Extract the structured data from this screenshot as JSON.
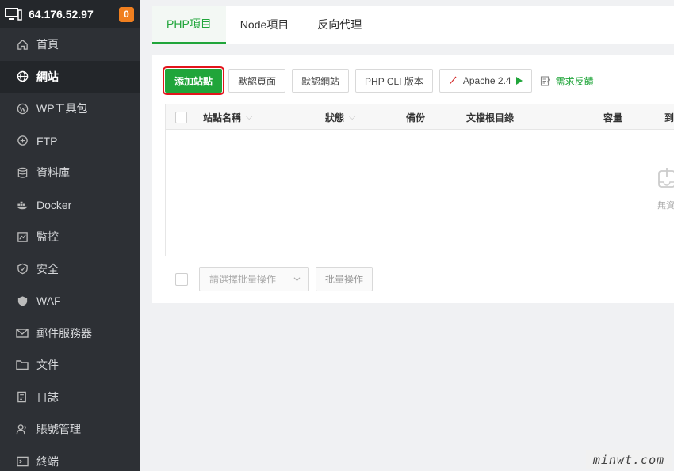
{
  "header": {
    "ip": "64.176.52.97",
    "badge": "0"
  },
  "sidebar": {
    "items": [
      {
        "label": "首頁",
        "icon": "home-icon"
      },
      {
        "label": "網站",
        "icon": "globe-icon",
        "active": true
      },
      {
        "label": "WP工具包",
        "icon": "wordpress-icon"
      },
      {
        "label": "FTP",
        "icon": "ftp-icon"
      },
      {
        "label": "資料庫",
        "icon": "database-icon"
      },
      {
        "label": "Docker",
        "icon": "docker-icon"
      },
      {
        "label": "監控",
        "icon": "monitor-icon"
      },
      {
        "label": "安全",
        "icon": "shield-icon"
      },
      {
        "label": "WAF",
        "icon": "waf-shield-icon"
      },
      {
        "label": "郵件服務器",
        "icon": "mail-icon"
      },
      {
        "label": "文件",
        "icon": "folder-icon"
      },
      {
        "label": "日誌",
        "icon": "log-icon"
      },
      {
        "label": "賬號管理",
        "icon": "user-icon"
      },
      {
        "label": "終端",
        "icon": "terminal-icon"
      }
    ]
  },
  "tabs": [
    {
      "label": "PHP項目",
      "active": true
    },
    {
      "label": "Node項目"
    },
    {
      "label": "反向代理"
    }
  ],
  "toolbar": {
    "add_site": "添加站點",
    "default_page": "默認頁面",
    "default_site": "默認網站",
    "php_cli": "PHP CLI 版本",
    "apache": "Apache 2.4",
    "feedback": "需求反饋"
  },
  "table": {
    "columns": {
      "site_name": "站點名稱",
      "status": "狀態",
      "backup": "備份",
      "root_dir": "文檔根目錄",
      "capacity": "容量",
      "expire": "到"
    },
    "empty_text": "無資"
  },
  "batch": {
    "placeholder": "請選擇批量操作",
    "button": "批量操作"
  },
  "watermark": "minwt.com",
  "colors": {
    "accent": "#20a53a",
    "sidebar": "#2d3035",
    "badge": "#f07f1f",
    "highlight": "#e3151c"
  }
}
